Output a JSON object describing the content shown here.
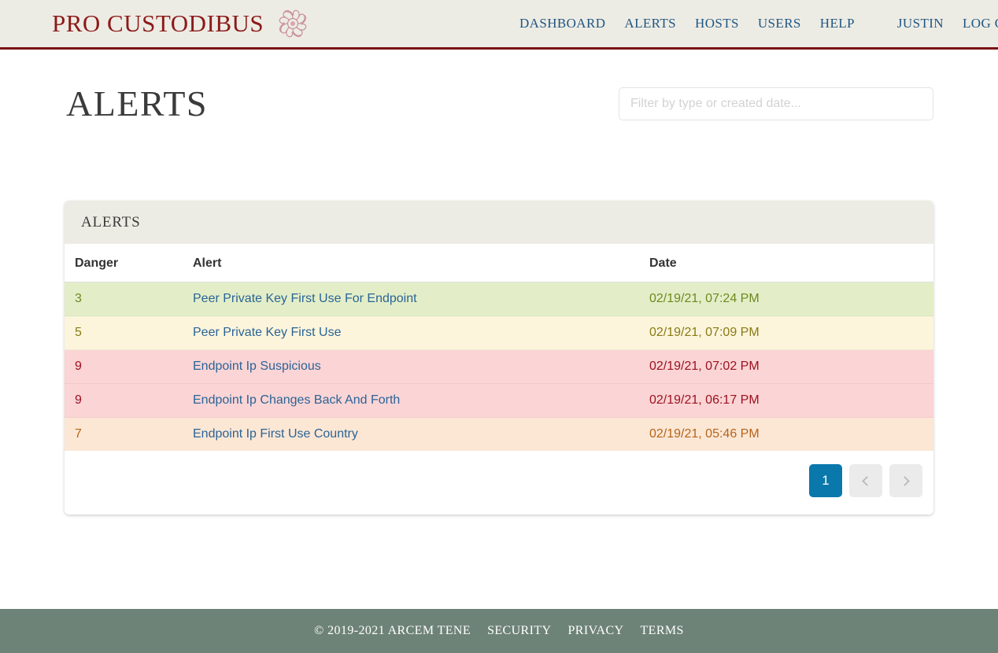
{
  "header": {
    "brand_name": "PRO CUSTODIBUS",
    "brand_mark_icon": "medusa-head-ornament-icon",
    "nav": [
      {
        "label": "DASHBOARD"
      },
      {
        "label": "ALERTS"
      },
      {
        "label": "HOSTS"
      },
      {
        "label": "USERS"
      },
      {
        "label": "HELP"
      }
    ],
    "user_nav": [
      {
        "label": "JUSTIN"
      },
      {
        "label": "LOG OUT"
      }
    ]
  },
  "page": {
    "title": "ALERTS",
    "filter": {
      "placeholder": "Filter by type or created date...",
      "value": ""
    }
  },
  "card": {
    "title": "ALERTS",
    "columns": [
      {
        "key": "danger",
        "label": "Danger"
      },
      {
        "key": "alert",
        "label": "Alert"
      },
      {
        "key": "date",
        "label": "Date"
      }
    ],
    "rows": [
      {
        "danger": "3",
        "alert": "Peer Private Key First Use For Endpoint",
        "date": "02/19/21, 07:24 PM",
        "severity": "low"
      },
      {
        "danger": "5",
        "alert": "Peer Private Key First Use",
        "date": "02/19/21, 07:09 PM",
        "severity": "med"
      },
      {
        "danger": "9",
        "alert": "Endpoint Ip Suspicious",
        "date": "02/19/21, 07:02 PM",
        "severity": "high"
      },
      {
        "danger": "9",
        "alert": "Endpoint Ip Changes Back And Forth",
        "date": "02/19/21, 06:17 PM",
        "severity": "high"
      },
      {
        "danger": "7",
        "alert": "Endpoint Ip First Use Country",
        "date": "02/19/21, 05:46 PM",
        "severity": "warn"
      }
    ],
    "pagination": {
      "current_page": "1",
      "prev_icon": "chevron-left-icon",
      "next_icon": "chevron-right-icon"
    }
  },
  "footer": {
    "copyright": "© 2019-2021 ARCEM TENE",
    "links": [
      {
        "label": "SECURITY"
      },
      {
        "label": "PRIVACY"
      },
      {
        "label": "TERMS"
      }
    ]
  },
  "colors": {
    "brand_maroon": "#8c1a1a",
    "header_bg": "#edece4",
    "header_rule": "#7a1012",
    "nav_link": "#1f5582",
    "alert_link": "#2a6496",
    "pager_active": "#0a78ab",
    "footer_bg": "#6e8377",
    "sev_low_bg": "#e3eec8",
    "sev_med_bg": "#fcf5dc",
    "sev_high_bg": "#fbd4d5",
    "sev_warn_bg": "#fce7d5"
  }
}
